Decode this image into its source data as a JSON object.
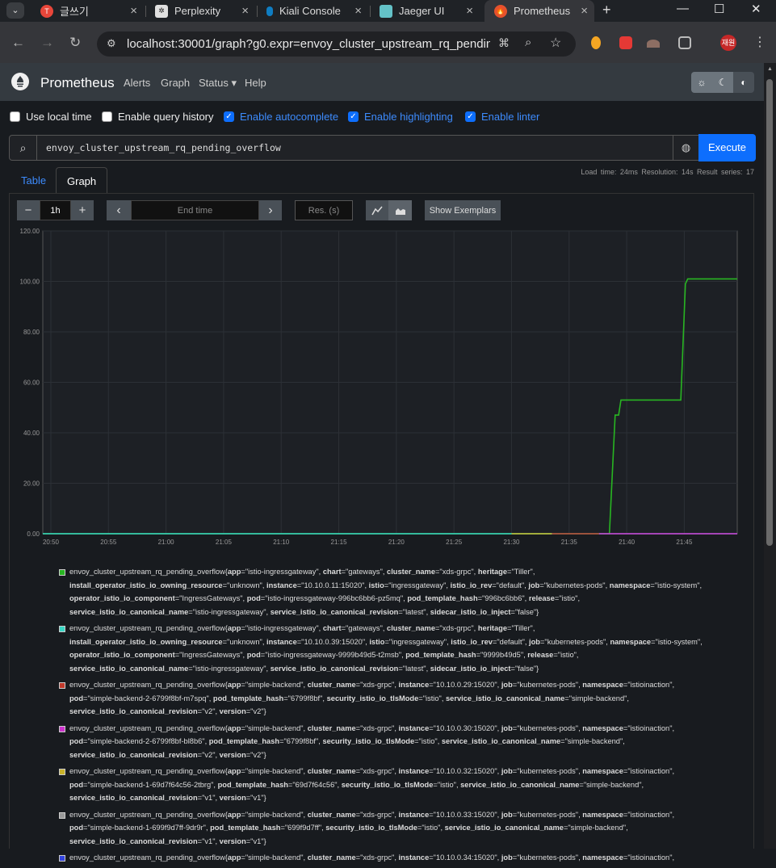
{
  "browser": {
    "tabs": [
      {
        "title": "글쓰기",
        "icon": "tistory-icon",
        "color": "#e8463a"
      },
      {
        "title": "Perplexity",
        "icon": "perplexity-icon",
        "color": "#1f2226"
      },
      {
        "title": "Kiali Console",
        "icon": "kiali-icon",
        "color": "#0f7dc2"
      },
      {
        "title": "Jaeger UI",
        "icon": "jaeger-icon",
        "color": "#64c2c8"
      },
      {
        "title": "Prometheus",
        "icon": "prometheus-icon",
        "color": "#e6522c"
      }
    ],
    "url": "localhost:30001/graph?g0.expr=envoy_cluster_upstream_rq_pending_...",
    "profile_label": "재원"
  },
  "nav": {
    "brand": "Prometheus",
    "links": [
      "Alerts",
      "Graph",
      "Status ▾",
      "Help"
    ],
    "theme_buttons": [
      "☼",
      "☾",
      "◐"
    ]
  },
  "options": [
    {
      "label": "Use local time",
      "checked": false
    },
    {
      "label": "Enable query history",
      "checked": false
    },
    {
      "label": "Enable autocomplete",
      "checked": true
    },
    {
      "label": "Enable highlighting",
      "checked": true
    },
    {
      "label": "Enable linter",
      "checked": true
    }
  ],
  "query": {
    "expression": "envoy_cluster_upstream_rq_pending_overflow",
    "execute_label": "Execute",
    "stats": "Load time: 24ms   Resolution: 14s   Result series: 17"
  },
  "tabs": {
    "table": "Table",
    "graph": "Graph"
  },
  "controls": {
    "range": "1h",
    "minus": "−",
    "plus": "+",
    "prev": "‹",
    "next": "›",
    "end_time_placeholder": "End time",
    "res_placeholder": "Res. (s)",
    "exemplars_label": "Show Exemplars"
  },
  "chart_data": {
    "type": "line",
    "ylim": [
      0,
      120
    ],
    "y_ticks": [
      "0.00",
      "20.00",
      "40.00",
      "60.00",
      "80.00",
      "100.00",
      "120.00"
    ],
    "x_ticks": [
      "20:50",
      "20:55",
      "21:00",
      "21:05",
      "21:10",
      "21:15",
      "21:20",
      "21:25",
      "21:30",
      "21:35",
      "21:40",
      "21:45"
    ],
    "x_range_minutes": [
      49.3,
      109.6
    ],
    "series": [
      {
        "color": "#28b522",
        "x": [
          49.3,
          98.5,
          99.0,
          99.3,
          99.5,
          104.7,
          105.1,
          105.3,
          109.6
        ],
        "y": [
          0,
          0,
          47,
          47,
          53,
          53,
          99,
          101,
          101
        ]
      },
      {
        "color": "#3ad6c4",
        "x": [
          49.3,
          109.6
        ],
        "y": [
          0,
          0
        ]
      },
      {
        "color": "#c0392b",
        "x": [
          93.5,
          97.6
        ],
        "y": [
          0,
          0
        ]
      },
      {
        "color": "#cc33cc",
        "x": [
          97.6,
          109.6
        ],
        "y": [
          0,
          0
        ]
      },
      {
        "color": "#c8b22a",
        "x": [
          90.0,
          93.5
        ],
        "y": [
          0,
          0
        ]
      }
    ]
  },
  "legend": [
    {
      "color": "#28b522",
      "metric": "envoy_cluster_upstream_rq_pending_overflow",
      "labels": [
        [
          "app",
          "istio-ingressgateway"
        ],
        [
          "chart",
          "gateways"
        ],
        [
          "cluster_name",
          "xds-grpc"
        ],
        [
          "heritage",
          "Tiller"
        ],
        [
          "install_operator_istio_io_owning_resource",
          "unknown"
        ],
        [
          "instance",
          "10.10.0.11:15020"
        ],
        [
          "istio",
          "ingressgateway"
        ],
        [
          "istio_io_rev",
          "default"
        ],
        [
          "job",
          "kubernetes-pods"
        ],
        [
          "namespace",
          "istio-system"
        ],
        [
          "operator_istio_io_component",
          "IngressGateways"
        ],
        [
          "pod",
          "istio-ingressgateway-996bc6bb6-pz5mq"
        ],
        [
          "pod_template_hash",
          "996bc6bb6"
        ],
        [
          "release",
          "istio"
        ],
        [
          "service_istio_io_canonical_name",
          "istio-ingressgateway"
        ],
        [
          "service_istio_io_canonical_revision",
          "latest"
        ],
        [
          "sidecar_istio_io_inject",
          "false"
        ]
      ]
    },
    {
      "color": "#3ad6c4",
      "metric": "envoy_cluster_upstream_rq_pending_overflow",
      "labels": [
        [
          "app",
          "istio-ingressgateway"
        ],
        [
          "chart",
          "gateways"
        ],
        [
          "cluster_name",
          "xds-grpc"
        ],
        [
          "heritage",
          "Tiller"
        ],
        [
          "install_operator_istio_io_owning_resource",
          "unknown"
        ],
        [
          "instance",
          "10.10.0.39:15020"
        ],
        [
          "istio",
          "ingressgateway"
        ],
        [
          "istio_io_rev",
          "default"
        ],
        [
          "job",
          "kubernetes-pods"
        ],
        [
          "namespace",
          "istio-system"
        ],
        [
          "operator_istio_io_component",
          "IngressGateways"
        ],
        [
          "pod",
          "istio-ingressgateway-9999b49d5-t2msb"
        ],
        [
          "pod_template_hash",
          "9999b49d5"
        ],
        [
          "release",
          "istio"
        ],
        [
          "service_istio_io_canonical_name",
          "istio-ingressgateway"
        ],
        [
          "service_istio_io_canonical_revision",
          "latest"
        ],
        [
          "sidecar_istio_io_inject",
          "false"
        ]
      ]
    },
    {
      "color": "#c0392b",
      "metric": "envoy_cluster_upstream_rq_pending_overflow",
      "labels": [
        [
          "app",
          "simple-backend"
        ],
        [
          "cluster_name",
          "xds-grpc"
        ],
        [
          "instance",
          "10.10.0.29:15020"
        ],
        [
          "job",
          "kubernetes-pods"
        ],
        [
          "namespace",
          "istioinaction"
        ],
        [
          "pod",
          "simple-backend-2-6799f8bf-m7spq"
        ],
        [
          "pod_template_hash",
          "6799f8bf"
        ],
        [
          "security_istio_io_tlsMode",
          "istio"
        ],
        [
          "service_istio_io_canonical_name",
          "simple-backend"
        ],
        [
          "service_istio_io_canonical_revision",
          "v2"
        ],
        [
          "version",
          "v2"
        ]
      ]
    },
    {
      "color": "#cc33cc",
      "metric": "envoy_cluster_upstream_rq_pending_overflow",
      "labels": [
        [
          "app",
          "simple-backend"
        ],
        [
          "cluster_name",
          "xds-grpc"
        ],
        [
          "instance",
          "10.10.0.30:15020"
        ],
        [
          "job",
          "kubernetes-pods"
        ],
        [
          "namespace",
          "istioinaction"
        ],
        [
          "pod",
          "simple-backend-2-6799f8bf-bl8b6"
        ],
        [
          "pod_template_hash",
          "6799f8bf"
        ],
        [
          "security_istio_io_tlsMode",
          "istio"
        ],
        [
          "service_istio_io_canonical_name",
          "simple-backend"
        ],
        [
          "service_istio_io_canonical_revision",
          "v2"
        ],
        [
          "version",
          "v2"
        ]
      ]
    },
    {
      "color": "#c8b22a",
      "metric": "envoy_cluster_upstream_rq_pending_overflow",
      "labels": [
        [
          "app",
          "simple-backend"
        ],
        [
          "cluster_name",
          "xds-grpc"
        ],
        [
          "instance",
          "10.10.0.32:15020"
        ],
        [
          "job",
          "kubernetes-pods"
        ],
        [
          "namespace",
          "istioinaction"
        ],
        [
          "pod",
          "simple-backend-1-69d7f64c56-2tbrg"
        ],
        [
          "pod_template_hash",
          "69d7f64c56"
        ],
        [
          "security_istio_io_tlsMode",
          "istio"
        ],
        [
          "service_istio_io_canonical_name",
          "simple-backend"
        ],
        [
          "service_istio_io_canonical_revision",
          "v1"
        ],
        [
          "version",
          "v1"
        ]
      ]
    },
    {
      "color": "#999999",
      "metric": "envoy_cluster_upstream_rq_pending_overflow",
      "labels": [
        [
          "app",
          "simple-backend"
        ],
        [
          "cluster_name",
          "xds-grpc"
        ],
        [
          "instance",
          "10.10.0.33:15020"
        ],
        [
          "job",
          "kubernetes-pods"
        ],
        [
          "namespace",
          "istioinaction"
        ],
        [
          "pod",
          "simple-backend-1-699f9d7ff-9dr9r"
        ],
        [
          "pod_template_hash",
          "699f9d7ff"
        ],
        [
          "security_istio_io_tlsMode",
          "istio"
        ],
        [
          "service_istio_io_canonical_name",
          "simple-backend"
        ],
        [
          "service_istio_io_canonical_revision",
          "v1"
        ],
        [
          "version",
          "v1"
        ]
      ]
    },
    {
      "color": "#3344dd",
      "metric": "envoy_cluster_upstream_rq_pending_overflow",
      "labels": [
        [
          "app",
          "simple-backend"
        ],
        [
          "cluster_name",
          "xds-grpc"
        ],
        [
          "instance",
          "10.10.0.34:15020"
        ],
        [
          "job",
          "kubernetes-pods"
        ],
        [
          "namespace",
          "istioinaction"
        ]
      ]
    }
  ]
}
